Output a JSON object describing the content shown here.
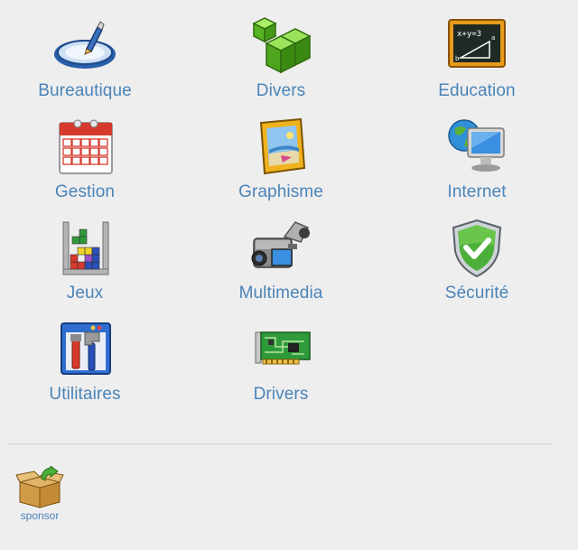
{
  "categories": [
    {
      "label": "Bureautique",
      "icon": "office-tablet-icon"
    },
    {
      "label": "Divers",
      "icon": "green-cubes-icon"
    },
    {
      "label": "Education",
      "icon": "chalkboard-icon"
    },
    {
      "label": "Gestion",
      "icon": "calendar-icon"
    },
    {
      "label": "Graphisme",
      "icon": "picture-frame-icon"
    },
    {
      "label": "Internet",
      "icon": "globe-monitor-icon"
    },
    {
      "label": "Jeux",
      "icon": "tetris-icon"
    },
    {
      "label": "Multimedia",
      "icon": "camcorder-icon"
    },
    {
      "label": "Sécurité",
      "icon": "shield-check-icon"
    },
    {
      "label": "Utilitaires",
      "icon": "tools-window-icon"
    },
    {
      "label": "Drivers",
      "icon": "circuit-board-icon"
    }
  ],
  "sponsor": {
    "label": "sponsor",
    "icon": "open-box-icon"
  },
  "colors": {
    "label": "#4a84b9",
    "background": "#eeeeee",
    "divider": "#cfcfcf"
  }
}
